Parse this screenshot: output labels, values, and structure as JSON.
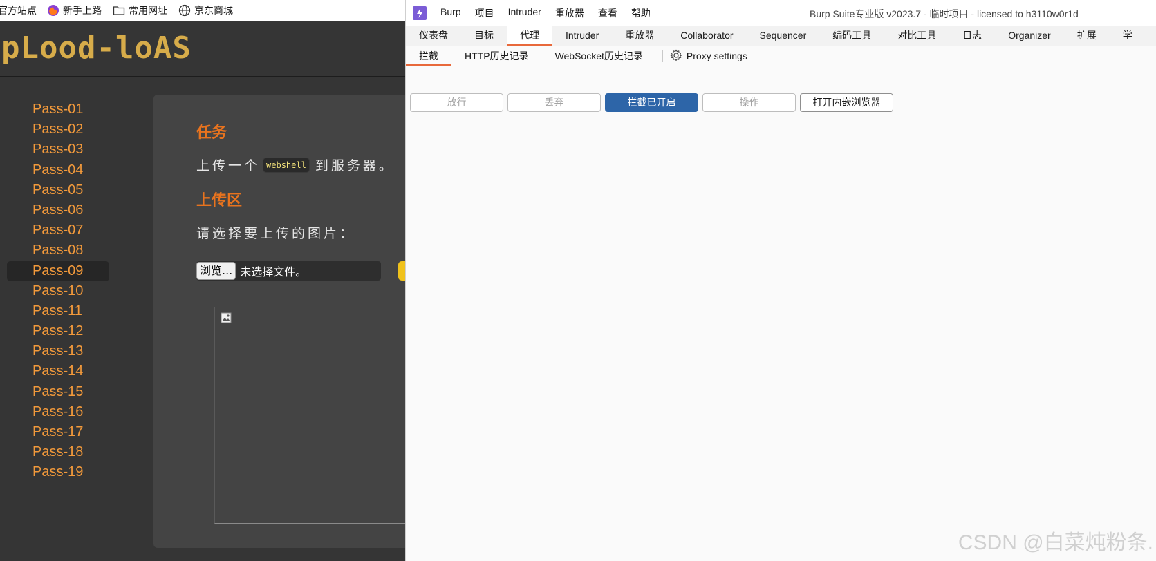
{
  "browser": {
    "bookmarks": [
      {
        "label": "官方站点",
        "icon": "folder-icon"
      },
      {
        "label": "新手上路",
        "icon": "firefox-icon"
      },
      {
        "label": "常用网址",
        "icon": "folder-icon"
      },
      {
        "label": "京东商城",
        "icon": "globe-icon"
      }
    ]
  },
  "site": {
    "logo": "pLood-loAS",
    "passes": [
      {
        "label": "Pass-01"
      },
      {
        "label": "Pass-02"
      },
      {
        "label": "Pass-03"
      },
      {
        "label": "Pass-04"
      },
      {
        "label": "Pass-05"
      },
      {
        "label": "Pass-06"
      },
      {
        "label": "Pass-07"
      },
      {
        "label": "Pass-08"
      },
      {
        "label": "Pass-09"
      },
      {
        "label": "Pass-10"
      },
      {
        "label": "Pass-11"
      },
      {
        "label": "Pass-12"
      },
      {
        "label": "Pass-13"
      },
      {
        "label": "Pass-14"
      },
      {
        "label": "Pass-15"
      },
      {
        "label": "Pass-16"
      },
      {
        "label": "Pass-17"
      },
      {
        "label": "Pass-18"
      },
      {
        "label": "Pass-19"
      }
    ],
    "active_pass": "Pass-09",
    "task_title": "任务",
    "task_text_before": "上传一个",
    "task_code": "webshell",
    "task_text_after": "到服务器。",
    "upload_title": "上传区",
    "upload_prompt": "请选择要上传的图片：",
    "browse_label": "浏览...",
    "file_status": "未选择文件。"
  },
  "burp": {
    "menu": [
      "Burp",
      "项目",
      "Intruder",
      "重放器",
      "查看",
      "帮助"
    ],
    "window_title": "Burp Suite专业版  v2023.7 - 临时项目 - licensed to h3110w0r1d",
    "main_tabs": [
      "仪表盘",
      "目标",
      "代理",
      "Intruder",
      "重放器",
      "Collaborator",
      "Sequencer",
      "编码工具",
      "对比工具",
      "日志",
      "Organizer",
      "扩展",
      "学"
    ],
    "active_main_tab": "代理",
    "sub_tabs": [
      "拦截",
      "HTTP历史记录",
      "WebSocket历史记录"
    ],
    "active_sub_tab": "拦截",
    "proxy_settings_label": "Proxy settings",
    "toolbar": {
      "forward": "放行",
      "drop": "丢弃",
      "intercept": "拦截已开启",
      "action": "操作",
      "open_browser": "打开内嵌浏览器"
    },
    "accent_color": "#e8693b",
    "primary_button_color": "#2d65a8"
  },
  "watermark": "CSDN @白菜炖粉条."
}
